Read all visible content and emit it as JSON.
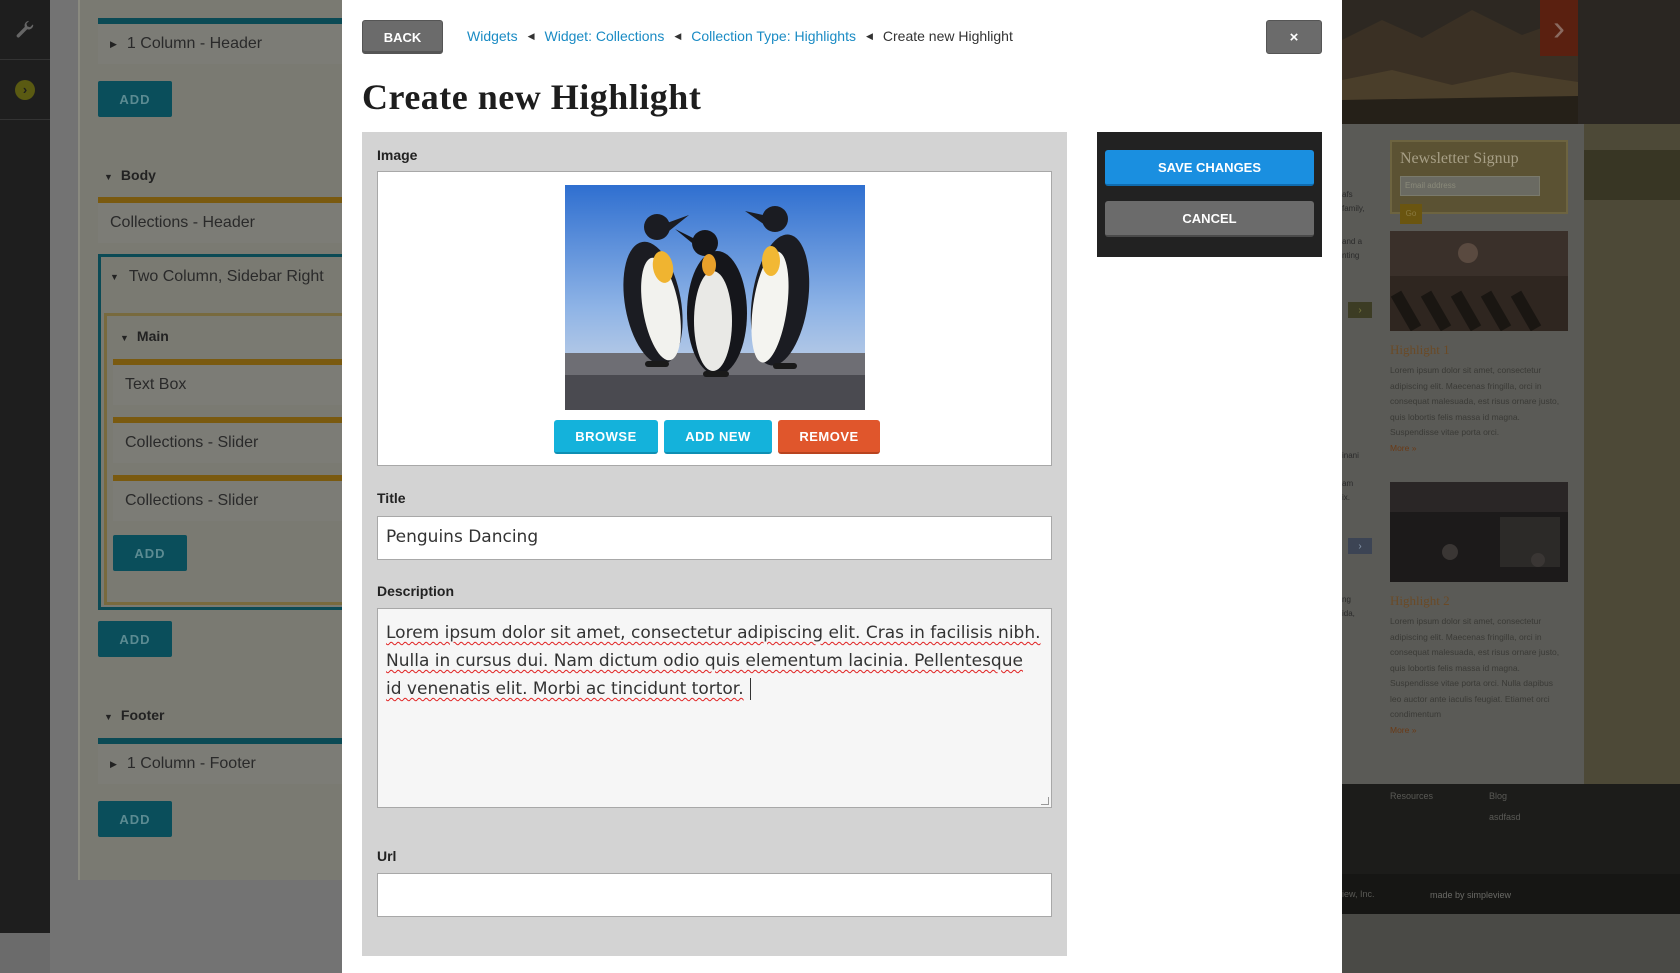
{
  "background_builder": {
    "sections": {
      "body_label": "Body",
      "main_label": "Main",
      "footer_label": "Footer"
    },
    "blocks": {
      "header": "1 Column - Header",
      "collections_header": "Collections - Header",
      "two_column": "Two Column, Sidebar Right",
      "text_box": "Text Box",
      "slider_1": "Collections - Slider",
      "slider_2": "Collections - Slider",
      "footer": "1 Column - Footer"
    },
    "add_label": "ADD"
  },
  "background_site": {
    "newsletter_title": "Newsletter Signup",
    "newsletter_placeholder": "Email address",
    "newsletter_go": "Go",
    "highlight1_title": "Highlight 1",
    "highlight1_body": "Lorem ipsum dolor sit amet, consectetur adipiscing elit. Maecenas fringilla, orci in consequat malesuada, est risus ornare justo, quis lobortis felis massa id magna. Suspendisse vitae porta orci.",
    "highlight2_title": "Highlight 2",
    "highlight2_body": "Lorem ipsum dolor sit amet, consectetur adipiscing elit. Maecenas fringilla, orci in consequat malesuada, est risus ornare justo, quis lobortis felis massa id magna. Suspendisse vitae porta orci. Nulla dapibus leo auctor ante iaculis feugiat. Etiamet orci condimentum",
    "more_label": "More »",
    "footer_resources": "Resources",
    "footer_blog": "Blog",
    "footer_sub": "asdfasd",
    "footer_inc": "iew, Inc.",
    "made_by": "made by simpleview"
  },
  "modal": {
    "back_label": "BACK",
    "close_label": "×",
    "breadcrumb": {
      "items": [
        "Widgets",
        "Widget: Collections",
        "Collection Type: Highlights"
      ],
      "current": "Create new Highlight"
    },
    "title": "Create new Highlight",
    "form": {
      "image_label": "Image",
      "image_subject": "three emperor penguins dancing",
      "browse_label": "BROWSE",
      "add_new_label": "ADD NEW",
      "remove_label": "REMOVE",
      "title_label": "Title",
      "title_value": "Penguins Dancing",
      "description_label": "Description",
      "description_value": "Lorem ipsum dolor sit amet, consectetur adipiscing elit. Cras in facilisis nibh. Nulla in cursus dui. Nam dictum odio quis elementum lacinia. Pellentesque id venenatis elit. Morbi ac tincidunt tortor.",
      "url_label": "Url",
      "url_value": ""
    },
    "actions": {
      "save_label": "SAVE CHANGES",
      "cancel_label": "CANCEL"
    }
  },
  "colors": {
    "link": "#1a8bc4",
    "primary_button": "#1a8fe0",
    "image_button": "#14b2db",
    "remove_button": "#e0562c",
    "panel": "#d3d3d3"
  }
}
